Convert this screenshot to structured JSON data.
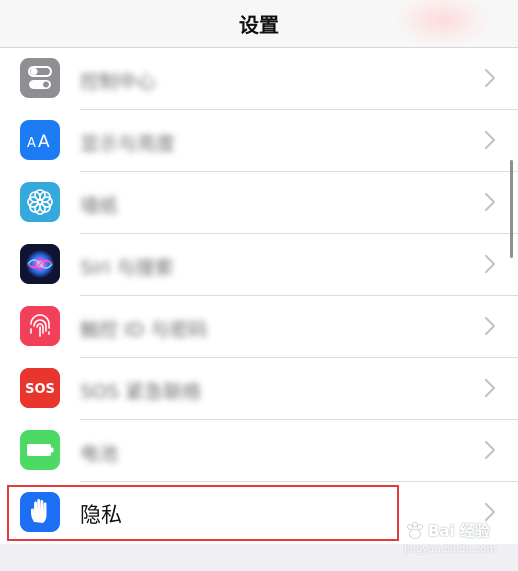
{
  "nav": {
    "title": "设置"
  },
  "rows": [
    {
      "name": "control-center",
      "label": "控制中心",
      "icon": "toggles-icon",
      "color": "#8e8e93",
      "blurred": true
    },
    {
      "name": "display-brightness",
      "label": "显示与亮度",
      "icon": "text-size-icon",
      "color": "#1c7cf4",
      "blurred": true
    },
    {
      "name": "wallpaper",
      "label": "墙纸",
      "icon": "flower-icon",
      "color": "#35a8dc",
      "blurred": true
    },
    {
      "name": "siri-search",
      "label": "Siri 与搜索",
      "icon": "siri-icon",
      "color": "#1b1b3a",
      "blurred": true
    },
    {
      "name": "touch-id-passcode",
      "label": "触控 ID 与密码",
      "icon": "fingerprint-icon",
      "color": "#f2405a",
      "blurred": true
    },
    {
      "name": "emergency-sos",
      "label": "SOS 紧急联络",
      "icon": "sos-icon",
      "color": "#e8352d",
      "sos_text": "SOS",
      "blurred": true
    },
    {
      "name": "battery",
      "label": "电池",
      "icon": "battery-icon",
      "color": "#4cd964",
      "blurred": true
    },
    {
      "name": "privacy",
      "label": "隐私",
      "icon": "hand-icon",
      "color": "#1c6ef2",
      "blurred": false
    }
  ],
  "watermark": {
    "text": "Bai 经验",
    "sub": "jingyan.baidu.com"
  }
}
